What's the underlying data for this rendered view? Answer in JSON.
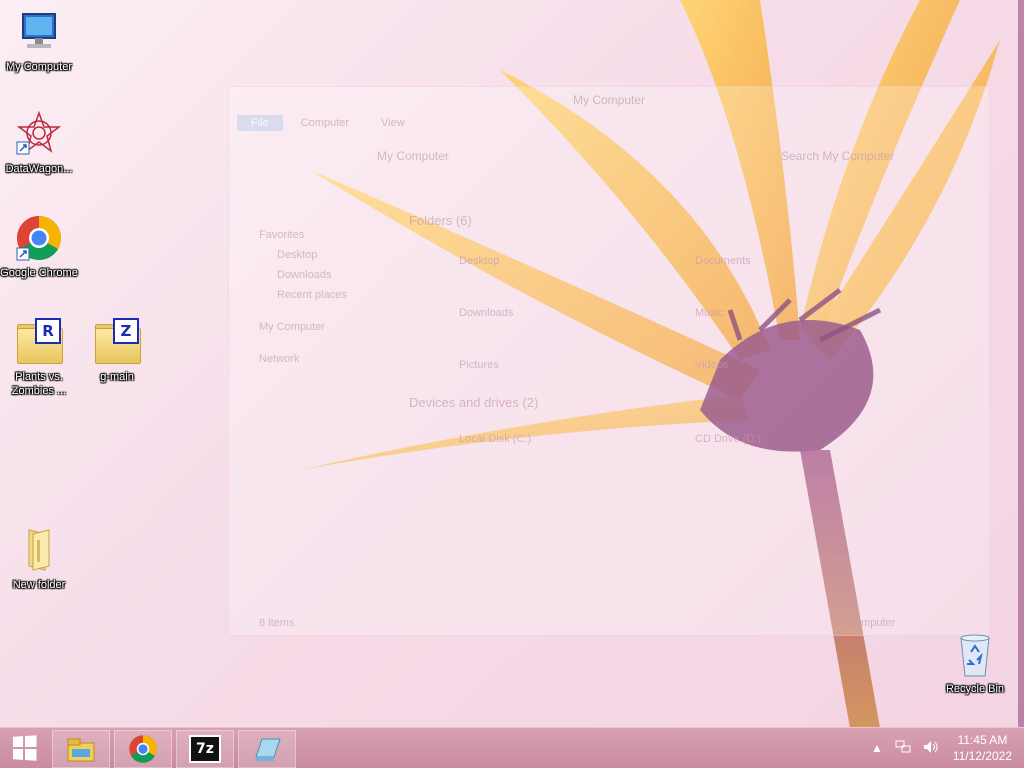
{
  "desktop_icons": {
    "my_computer": "My Computer",
    "datawagon": "DataWagon...",
    "chrome": "Google Chrome",
    "pvz": "Plants vs. Zombies ...",
    "gmain": "g-main",
    "new_folder": "New folder",
    "recycle_bin": "Recycle Bin"
  },
  "badges": {
    "pvz": "R",
    "gmain": "Z"
  },
  "ghost_window": {
    "title": "My Computer",
    "tabs": [
      "File",
      "Computer",
      "View"
    ],
    "address": "My Computer",
    "search": "Search My Computer",
    "nav": {
      "favorites": "Favorites",
      "desktop": "Desktop",
      "downloads": "Downloads",
      "recent": "Recent places",
      "computer": "My Computer",
      "network": "Network"
    },
    "sections": {
      "folders": "Folders (6)",
      "devices": "Devices and drives (2)"
    },
    "items": {
      "desktop": "Desktop",
      "documents": "Documents",
      "downloads": "Downloads",
      "music": "Music",
      "pictures": "Pictures",
      "videos": "Videos",
      "local_disk": "Local Disk (C:)",
      "cd_drive": "CD Drive (D:)"
    },
    "status": "8 items",
    "status_right": "Computer"
  },
  "taskbar": {
    "sevenzip_label": "7z"
  },
  "tray": {
    "time": "11:45 AM",
    "date": "11/12/2022"
  },
  "colors": {
    "taskbar": "#cf93a8",
    "petal": "#f6b23c",
    "stem": "#8a3f78"
  }
}
